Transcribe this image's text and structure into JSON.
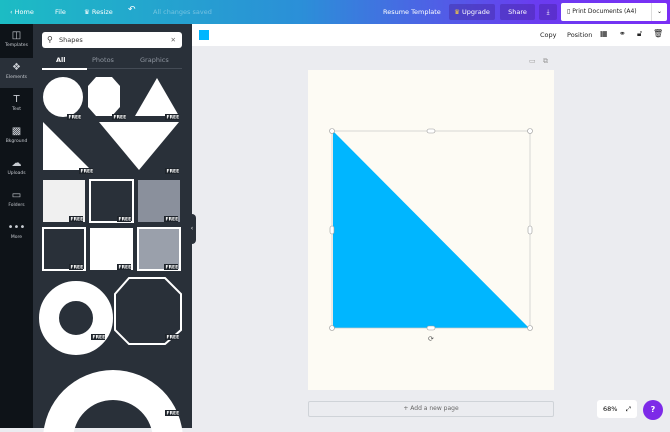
{
  "topbar": {
    "home": "Home",
    "file": "File",
    "resize": "Resize",
    "status": "All changes saved",
    "title": "Resume Template",
    "upgrade": "Upgrade",
    "share": "Share",
    "print": "Print Documents (A4)"
  },
  "rail": [
    {
      "icon": "templates-icon",
      "label": "Templates"
    },
    {
      "icon": "elements-icon",
      "label": "Elements"
    },
    {
      "icon": "text-icon",
      "label": "Text"
    },
    {
      "icon": "background-icon",
      "label": "Bkground"
    },
    {
      "icon": "uploads-icon",
      "label": "Uploads"
    },
    {
      "icon": "folders-icon",
      "label": "Folders"
    },
    {
      "icon": "more-icon",
      "label": "More"
    }
  ],
  "panel": {
    "search_value": "Shapes",
    "tabs": [
      "All",
      "Photos",
      "Graphics"
    ],
    "badge": "FREE"
  },
  "toolbar": {
    "color": "#00b6ff",
    "copy": "Copy",
    "position": "Position"
  },
  "canvas": {
    "shape_color": "#00b6ff",
    "add_page": "+ Add a new page",
    "zoom": "68%"
  },
  "help": "?"
}
